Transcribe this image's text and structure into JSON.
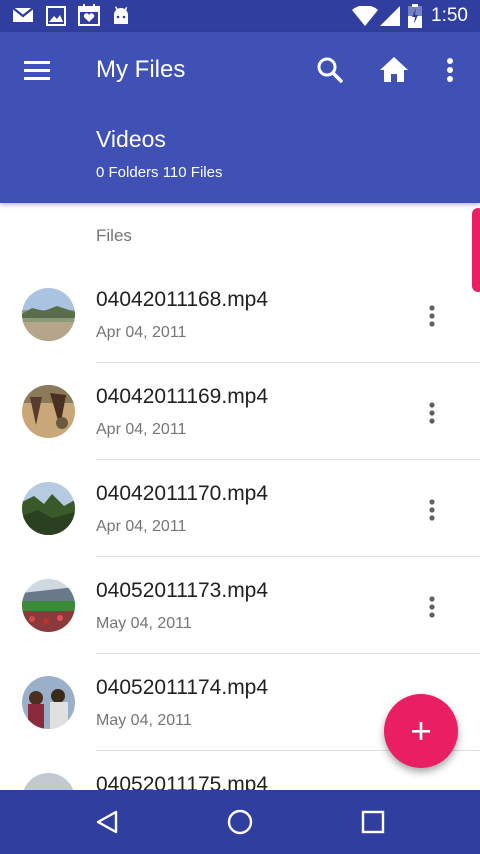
{
  "status_bar": {
    "time": "1:50",
    "icons": [
      "gmail-icon",
      "gallery-icon",
      "calendar-icon",
      "android-icon",
      "wifi-icon",
      "signal-icon",
      "battery-icon"
    ]
  },
  "app_bar": {
    "title": "My Files",
    "folder_title": "Videos",
    "folder_counts": "0 Folders 110 Files",
    "icons": [
      "menu-icon",
      "search-icon",
      "home-icon",
      "more-vert-icon"
    ]
  },
  "files": {
    "section_header": "Files",
    "items": [
      {
        "name": "04042011168.mp4",
        "date": "Apr 04, 2011"
      },
      {
        "name": "04042011169.mp4",
        "date": "Apr 04, 2011"
      },
      {
        "name": "04042011170.mp4",
        "date": "Apr 04, 2011"
      },
      {
        "name": "04052011173.mp4",
        "date": "May 04, 2011"
      },
      {
        "name": "04052011174.mp4",
        "date": "May 04, 2011"
      },
      {
        "name": "04052011175.mp4",
        "date": ""
      }
    ]
  },
  "fab": {
    "icon": "add-icon"
  },
  "nav_bar": {
    "icons": [
      "back-icon",
      "home-circle-icon",
      "recents-icon"
    ]
  },
  "colors": {
    "primary": "#3f51b5",
    "primary_dark": "#303f9f",
    "accent": "#e91e63"
  }
}
